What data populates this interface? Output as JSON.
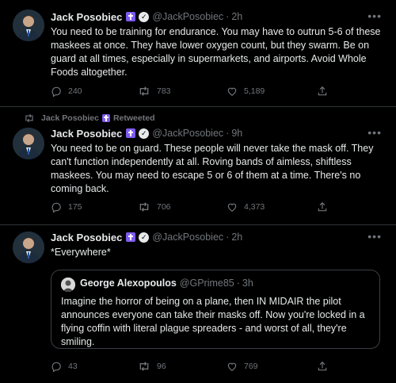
{
  "colors": {
    "background": "#000000",
    "text": "#e7e9ea",
    "muted": "#71767b",
    "divider": "#2f3336",
    "badge": "#7e5bef"
  },
  "tweets": [
    {
      "name": "Jack Posobiec",
      "handle": "@JackPosobiec",
      "dot": "·",
      "time": "2h",
      "text": "You need to be training for endurance. You may have to outrun 5-6 of these maskees at once. They have lower oxygen count, but they swarm. Be on guard at all times, especially in supermarkets, and airports. Avoid Whole Foods altogether.",
      "replies": "240",
      "retweets": "783",
      "likes": "5,189"
    },
    {
      "retweet_label": "Jack Posobiec",
      "retweet_suffix": "Retweeted",
      "name": "Jack Posobiec",
      "handle": "@JackPosobiec",
      "dot": "·",
      "time": "9h",
      "text": "You need to be on guard. These people will never take the mask off. They can't function independently at all. Roving bands of aimless, shiftless maskees. You may need to escape 5 or 6 of them at a time. There's no coming back.",
      "replies": "175",
      "retweets": "706",
      "likes": "4,373"
    },
    {
      "name": "Jack Posobiec",
      "handle": "@JackPosobiec",
      "dot": "·",
      "time": "2h",
      "text": "*Everywhere*",
      "quote": {
        "name": "George Alexopoulos",
        "handle": "@GPrime85",
        "dot": "·",
        "time": "3h",
        "text": "Imagine the horror of being on a plane, then IN MIDAIR the pilot announces everyone can take their masks off. Now you're locked in a flying coffin with literal plague spreaders - and worst of all, they're smiling."
      },
      "replies": "43",
      "retweets": "96",
      "likes": "769"
    }
  ],
  "icons": {
    "reply": "reply-icon",
    "retweet": "retweet-icon",
    "like": "heart-icon",
    "share": "share-icon",
    "more": "more-icon",
    "verified": "verified-icon",
    "badge": "cross-badge-icon"
  }
}
